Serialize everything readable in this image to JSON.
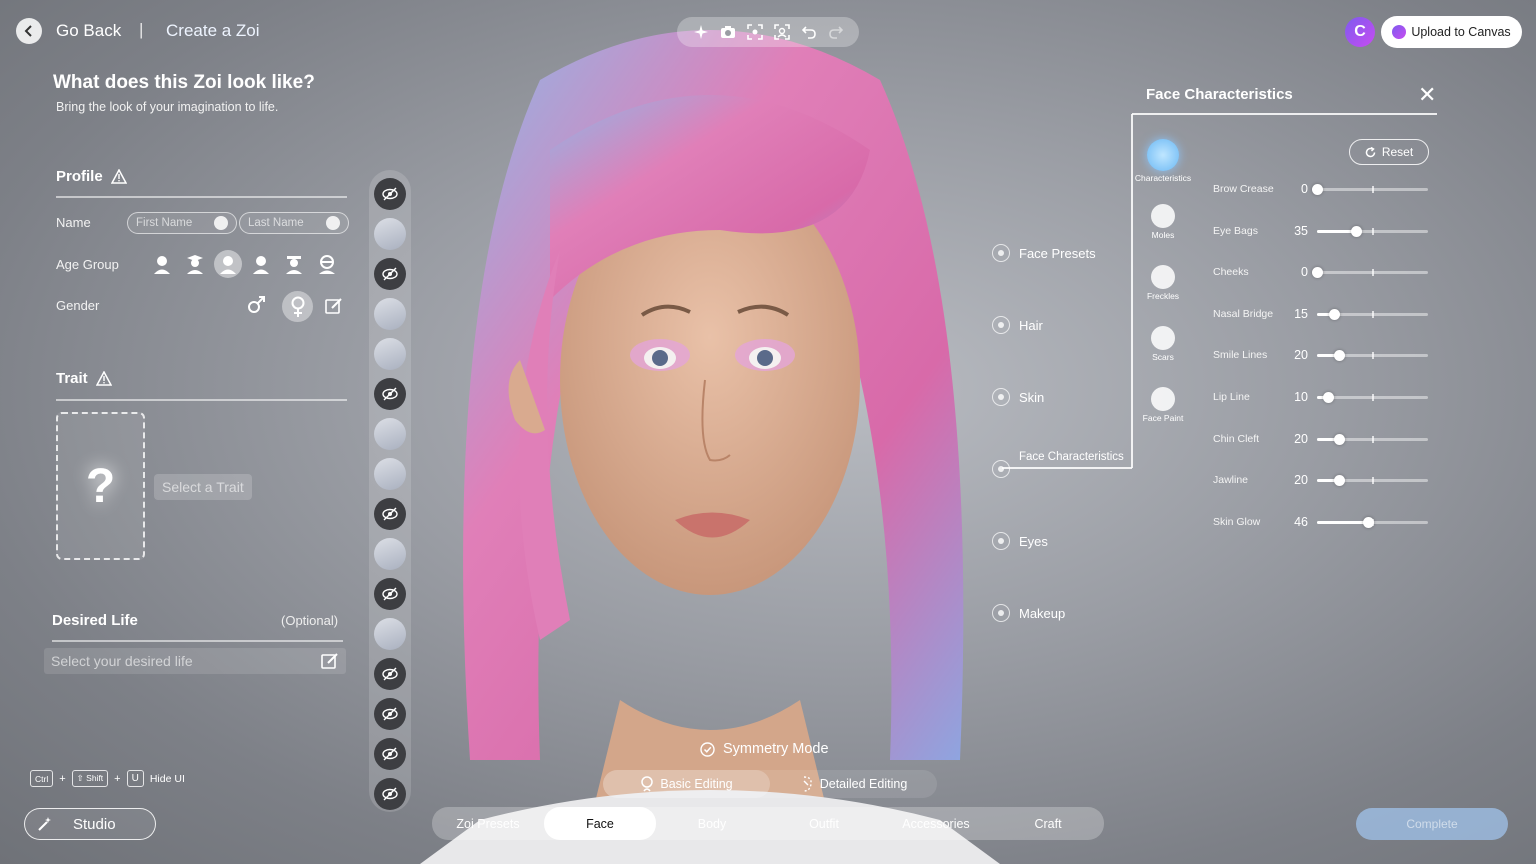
{
  "nav": {
    "back_label": "Go Back",
    "separator": "|",
    "breadcrumb": "Create a Zoi"
  },
  "toolbar": {
    "icons": [
      "sparkle-icon",
      "camera-icon",
      "focus-icon",
      "face-focus-icon",
      "undo-icon",
      "redo-icon"
    ]
  },
  "upload": {
    "logo_letter": "C",
    "label": "Upload to Canvas"
  },
  "left": {
    "title": "What does this Zoi look like?",
    "subtitle": "Bring the look of your imagination to life.",
    "profile": {
      "heading": "Profile",
      "name_label": "Name",
      "first_name_placeholder": "First Name",
      "last_name_placeholder": "Last Name",
      "age_label": "Age Group",
      "gender_label": "Gender"
    },
    "trait": {
      "heading": "Trait",
      "card_symbol": "?",
      "select_label": "Select a Trait"
    },
    "desired_life": {
      "heading": "Desired Life",
      "optional": "(Optional)",
      "placeholder": "Select your desired life"
    }
  },
  "hotkeys": {
    "keys": [
      "Ctrl",
      "⇧ Shift",
      "U"
    ],
    "plus": "+",
    "action": "Hide UI"
  },
  "studio": {
    "label": "Studio"
  },
  "categories": [
    "Face Presets",
    "Hair",
    "Skin",
    "Face Characteristics",
    "Eyes",
    "Makeup"
  ],
  "panel": {
    "title": "Face Characteristics",
    "close": "✕",
    "reset": "Reset",
    "side_tabs": [
      "Characteristics",
      "Moles",
      "Freckles",
      "Scars",
      "Face Paint"
    ],
    "sliders": [
      {
        "label": "Brow Crease",
        "value": "0",
        "level": 0
      },
      {
        "label": "Eye Bags",
        "value": "35",
        "level": 35
      },
      {
        "label": "Cheeks",
        "value": "0",
        "level": 0
      },
      {
        "label": "Nasal Bridge",
        "value": "15",
        "level": 15
      },
      {
        "label": "Smile Lines",
        "value": "20",
        "level": 20
      },
      {
        "label": "Lip Line",
        "value": "10",
        "level": 10
      },
      {
        "label": "Chin Cleft",
        "value": "20",
        "level": 20
      },
      {
        "label": "Jawline",
        "value": "20",
        "level": 20
      },
      {
        "label": "Skin Glow",
        "value": "46",
        "level": 46
      }
    ]
  },
  "bottom": {
    "symmetry": "Symmetry Mode",
    "basic_editing": "Basic Editing",
    "detailed_editing": "Detailed Editing",
    "tabs": [
      "Zoi Presets",
      "Face",
      "Body",
      "Outfit",
      "Accessories",
      "Craft"
    ],
    "active_tab": "Face",
    "complete": "Complete"
  }
}
